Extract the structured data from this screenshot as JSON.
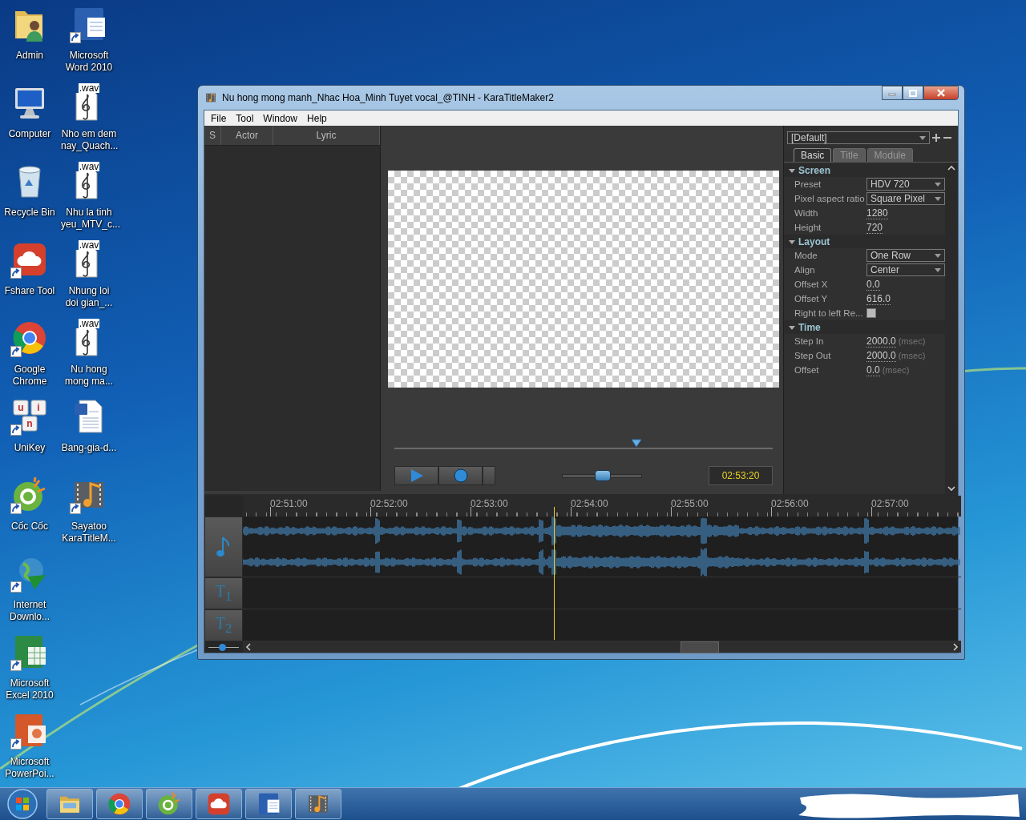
{
  "desktop_icons": [
    {
      "label": "Admin",
      "kind": "user-folder",
      "shortcut": false
    },
    {
      "label": "Computer",
      "kind": "computer",
      "shortcut": false
    },
    {
      "label": "Recycle Bin",
      "kind": "recycle",
      "shortcut": false
    },
    {
      "label": "Fshare Tool",
      "kind": "fshare",
      "shortcut": true
    },
    {
      "label": "Google Chrome",
      "kind": "chrome",
      "shortcut": true
    },
    {
      "label": "UniKey",
      "kind": "unikey",
      "shortcut": true,
      "key_letters": [
        "u",
        "i",
        "n"
      ]
    },
    {
      "label": "Cốc Cốc",
      "kind": "coccoc",
      "shortcut": true
    },
    {
      "label": "Internet Downlo...",
      "kind": "idm",
      "shortcut": true
    },
    {
      "label": "Microsoft Excel 2010",
      "kind": "excel",
      "shortcut": true
    },
    {
      "label": "Microsoft PowerPoi...",
      "kind": "powerpoint",
      "shortcut": true
    },
    {
      "label": "Microsoft Word 2010",
      "kind": "word",
      "shortcut": true
    },
    {
      "label": "Nho em dem nay_Quach...",
      "kind": "wav",
      "shortcut": false,
      "badge": ".wav"
    },
    {
      "label": "Nhu la tinh yeu_MTV_c...",
      "kind": "wav",
      "shortcut": false,
      "badge": ".wav"
    },
    {
      "label": "Nhung loi doi gian_...",
      "kind": "wav",
      "shortcut": false,
      "badge": ".wav"
    },
    {
      "label": "Nu hong mong ma...",
      "kind": "wav",
      "shortcut": false,
      "badge": ".wav"
    },
    {
      "label": "Bang-gia-d...",
      "kind": "worddoc",
      "shortcut": false
    },
    {
      "label": "Sayatoo KaraTitleM...",
      "kind": "sayatoo",
      "shortcut": true
    }
  ],
  "window": {
    "title": "Nu hong mong manh_Nhac Hoa_Minh Tuyet vocal_@TINH - KaraTitleMaker2"
  },
  "menu": [
    "File",
    "Tool",
    "Window",
    "Help"
  ],
  "lyric_list": {
    "columns": [
      "S",
      "Actor",
      "Lyric"
    ]
  },
  "player": {
    "seek": {
      "level": 0.64
    },
    "volume": {
      "level": 0.5
    },
    "time": "02:53:20"
  },
  "properties": {
    "preset": "[Default]",
    "tabs": [
      {
        "label": "Basic",
        "selected": true
      },
      {
        "label": "Title",
        "selected": false
      },
      {
        "label": "Module",
        "selected": false
      }
    ],
    "sections": [
      {
        "title": "Screen",
        "expanded": true,
        "rows": [
          {
            "label": "Preset",
            "kind": "dropdown",
            "value": "HDV 720"
          },
          {
            "label": "Pixel aspect ratio",
            "kind": "dropdown",
            "value": "Square Pixel"
          },
          {
            "label": "Width",
            "kind": "number",
            "value": "1280"
          },
          {
            "label": "Height",
            "kind": "number",
            "value": "720"
          }
        ]
      },
      {
        "title": "Layout",
        "expanded": true,
        "rows": [
          {
            "label": "Mode",
            "kind": "dropdown",
            "value": "One Row"
          },
          {
            "label": "Align",
            "kind": "dropdown",
            "value": "Center"
          },
          {
            "label": "Offset X",
            "kind": "number",
            "value": "0.0"
          },
          {
            "label": "Offset Y",
            "kind": "number",
            "value": "616.0"
          },
          {
            "label": "Right to left Re...",
            "kind": "checkbox",
            "checked": false
          }
        ]
      },
      {
        "title": "Time",
        "expanded": true,
        "rows": [
          {
            "label": "Step In",
            "kind": "number",
            "value": "2000.0",
            "unit": "(msec)"
          },
          {
            "label": "Step Out",
            "kind": "number",
            "value": "2000.0",
            "unit": "(msec)"
          },
          {
            "label": "Offset",
            "kind": "number",
            "value": "0.0",
            "unit": "(msec)"
          }
        ]
      }
    ]
  },
  "timeline": {
    "ruler": [
      "02:51:00",
      "02:52:00",
      "02:53:00",
      "02:54:00",
      "02:55:00",
      "02:56:00",
      "02:57:00"
    ],
    "tracks": [
      {
        "kind": "audio"
      },
      {
        "kind": "text",
        "label": "T$_{1}$"
      },
      {
        "kind": "text",
        "label": "T$_{2}$"
      }
    ],
    "playhead": {
      "level": 0.433
    },
    "zoom": {
      "level": 0.45
    }
  },
  "taskbar": {
    "items": [
      {
        "kind": "explorer"
      },
      {
        "kind": "chrome"
      },
      {
        "kind": "coccoc"
      },
      {
        "kind": "fshare"
      },
      {
        "kind": "word"
      },
      {
        "kind": "sayatoo"
      }
    ]
  }
}
